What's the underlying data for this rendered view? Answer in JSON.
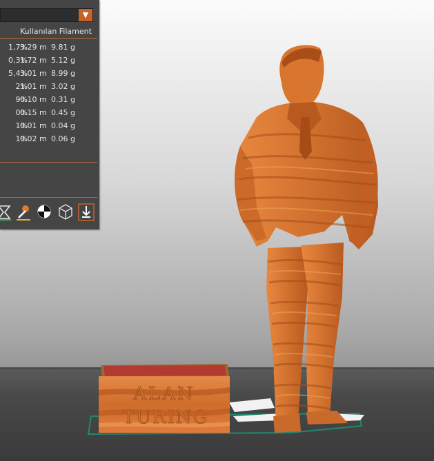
{
  "panel": {
    "column_header": "Kullanılan Filament",
    "rows": [
      {
        "pct": "1,7%",
        "length": "3.29 m",
        "weight": "9.81 g"
      },
      {
        "pct": "0,3%",
        "length": "1.72 m",
        "weight": "5.12 g"
      },
      {
        "pct": "5,4%",
        "length": "3.01 m",
        "weight": "8.99 g"
      },
      {
        "pct": "2%",
        "length": "1.01 m",
        "weight": "3.02 g"
      },
      {
        "pct": "9%",
        "length": "0.10 m",
        "weight": "0.31 g"
      },
      {
        "pct": "0%",
        "length": "0.15 m",
        "weight": "0.45 g"
      },
      {
        "pct": "1%",
        "length": "0.01 m",
        "weight": "0.04 g"
      },
      {
        "pct": "1%",
        "length": "0.02 m",
        "weight": "0.06 g"
      }
    ],
    "dropdown_icon": "chevron-down-icon",
    "toolbar_icons": [
      "hourglass-icon",
      "paint-brush-icon",
      "contrast-icon",
      "cube-wireframe-icon",
      "export-icon"
    ]
  },
  "model": {
    "box_text_line1": "ALAN",
    "box_text_line2": "TURING"
  },
  "colors": {
    "accent": "#c5632b",
    "panel_bg": "#454545",
    "model_orange": "#d97a3a",
    "box_top_red": "#b23a32",
    "bed_outline": "#1f8a72"
  }
}
